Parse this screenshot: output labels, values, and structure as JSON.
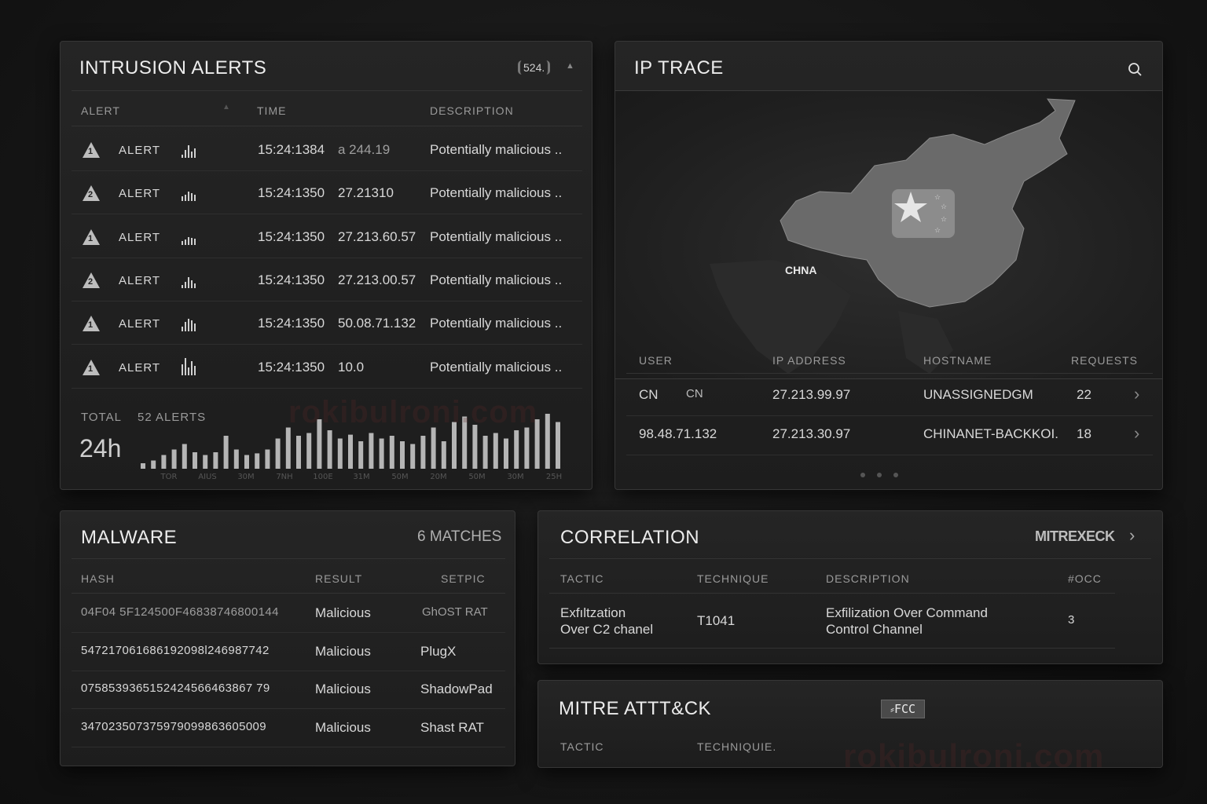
{
  "intrusion": {
    "title": "INTRUSION ALERTS",
    "count_badge": "524.",
    "headers": {
      "alert": "ALERT",
      "time": "TIME",
      "description": "DESCRIPTION"
    },
    "rows": [
      {
        "severity": "1",
        "label": "ALERT",
        "time": "15:24:1384",
        "ip": "a 244.19",
        "description": "Potentially malicious .."
      },
      {
        "severity": "2",
        "label": "ALERT",
        "time": "15:24:1350",
        "ip": "27.21310",
        "description": "Potentially malicious .."
      },
      {
        "severity": "1",
        "label": "ALERT",
        "time": "15:24:1350",
        "ip": "27.213.60.57",
        "description": "Potentially malicious .."
      },
      {
        "severity": "2",
        "label": "ALERT",
        "time": "15:24:1350",
        "ip": "27.213.00.57",
        "description": "Potentially malicious .."
      },
      {
        "severity": "1",
        "label": "ALERT",
        "time": "15:24:1350",
        "ip": "50.08.71.132",
        "description": "Potentially malicious .."
      },
      {
        "severity": "1",
        "label": "ALERT",
        "time": "15:24:1350",
        "ip": "10.0",
        "description": "Potentially malicious .."
      }
    ],
    "total_label": "TOTAL",
    "total_value": "52 ALERTS",
    "period": "24h",
    "histogram": [
      0.1,
      0.15,
      0.25,
      0.35,
      0.45,
      0.3,
      0.25,
      0.3,
      0.6,
      0.35,
      0.25,
      0.28,
      0.35,
      0.55,
      0.75,
      0.6,
      0.65,
      0.9,
      0.7,
      0.55,
      0.62,
      0.5,
      0.65,
      0.55,
      0.6,
      0.5,
      0.45,
      0.6,
      0.75,
      0.5,
      0.85,
      0.95,
      0.8,
      0.6,
      0.65,
      0.55,
      0.7,
      0.75,
      0.9,
      1.0,
      0.85
    ],
    "histogram_ticks": [
      "TOR",
      "AIUS",
      "30M",
      "7NH",
      "100E",
      "31M",
      "50M",
      "20M",
      "50M",
      "30M",
      "25H"
    ]
  },
  "ip_trace": {
    "title": "IP TRACE",
    "map_label": "CHNA",
    "headers": {
      "user": "USER",
      "ip": "IP ADDRESS",
      "hostname": "HOSTNAME",
      "requests": "REQUESTS"
    },
    "rows": [
      {
        "user": "CN",
        "user2": "CN",
        "ip": "27.213.99.97",
        "hostname": "UNASSIGNEDGM",
        "requests": "22"
      },
      {
        "user": "98.48.71.132",
        "user2": "",
        "ip": "27.213.30.97",
        "hostname": "CHINANET-BACKKOI.",
        "requests": "18"
      }
    ]
  },
  "malware": {
    "title": "MALWARE",
    "matches": "6 MATCHES",
    "headers": {
      "hash": "HASH",
      "result": "RESULT",
      "family": "SETPIC"
    },
    "rows": [
      {
        "hash": "04F04 5F124500F46838746800144",
        "result": "Malicious",
        "family": "GhOST RAT"
      },
      {
        "hash": "547217061686192098l246987742",
        "result": "Malicious",
        "family": "PlugX"
      },
      {
        "hash": "0758539365152424566463867 79",
        "result": "Malicious",
        "family": "ShadowPad"
      },
      {
        "hash": "347023507375979099863605009",
        "result": "Malicious",
        "family": "Shast RAT"
      }
    ]
  },
  "correlation": {
    "title": "CORRELATION",
    "link": "MITREXECK",
    "headers": {
      "tactic": "TACTIC",
      "technique": "TECHNIQUE",
      "description": "DESCRIPTION",
      "occ": "#OCC"
    },
    "rows": [
      {
        "tactic_line1": "Exfıltzation",
        "tactic_line2": "Over C2 chanel",
        "technique": "T1041",
        "desc_line1": "Exfilization Over Command",
        "desc_line2": "Control Channel",
        "occ": "3"
      }
    ]
  },
  "mitre": {
    "title": "MITRE ATTT&CK",
    "tag": "⸗FCC",
    "headers": {
      "tactic": "TACTIC",
      "technique": "TECHNIQUIE."
    }
  },
  "watermark": "rokibulroni.com"
}
